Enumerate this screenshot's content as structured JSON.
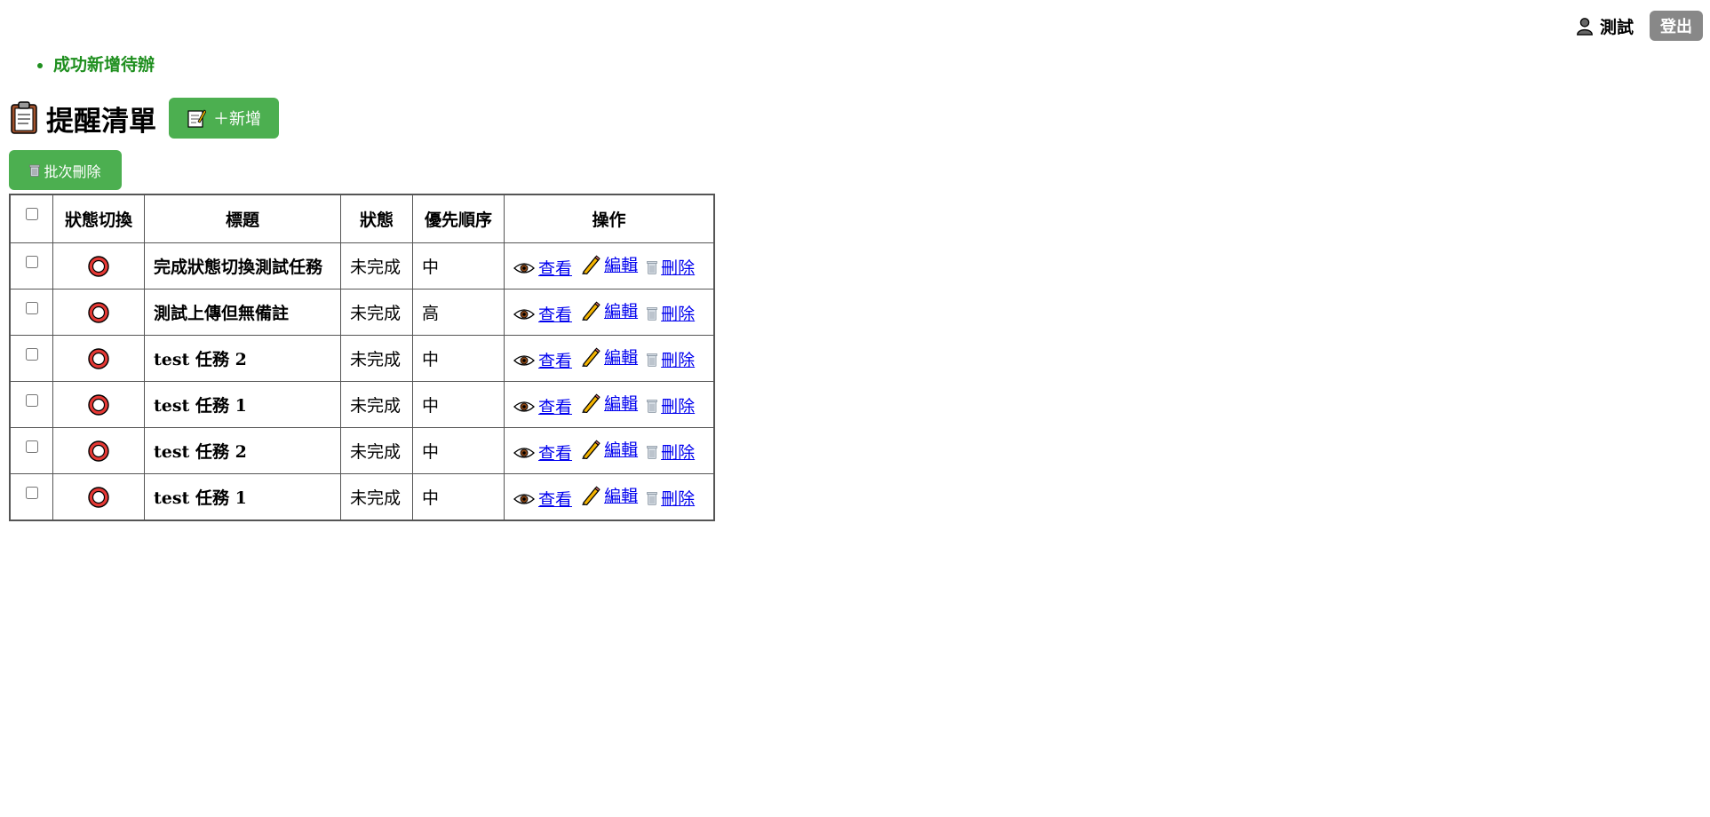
{
  "header": {
    "user_name": "測試",
    "logout_label": "登出"
  },
  "messages": [
    "成功新增待辦"
  ],
  "page": {
    "title": "提醒清單",
    "add_button_label": "＋新增",
    "batch_delete_label": "批次刪除"
  },
  "table": {
    "columns": [
      "狀態切換",
      "標題",
      "狀態",
      "優先順序",
      "操作"
    ],
    "action_labels": {
      "view": "查看",
      "edit": "編輯",
      "delete": "刪除"
    },
    "rows": [
      {
        "title": "完成狀態切換測試任務",
        "status": "未完成",
        "priority": "中"
      },
      {
        "title": "測試上傳但無備註",
        "status": "未完成",
        "priority": "高"
      },
      {
        "title": "test 任務 2",
        "status": "未完成",
        "priority": "中"
      },
      {
        "title": "test 任務 1",
        "status": "未完成",
        "priority": "中"
      },
      {
        "title": "test 任務 2",
        "status": "未完成",
        "priority": "中"
      },
      {
        "title": "test 任務 1",
        "status": "未完成",
        "priority": "中"
      }
    ]
  },
  "icons": {
    "user": "user-silhouette-icon",
    "title": "clipboard-icon",
    "add": "memo-icon",
    "batch": "wastebasket-icon",
    "toggle": "red-circle-icon",
    "view": "eye-icon",
    "edit": "pencil-icon",
    "delete": "wastebasket-icon"
  },
  "colors": {
    "accent": "#4caf50",
    "success_message": "#1f8f1f",
    "logout": "#888888",
    "link": "#0000ee",
    "toggle": "#e53935"
  }
}
